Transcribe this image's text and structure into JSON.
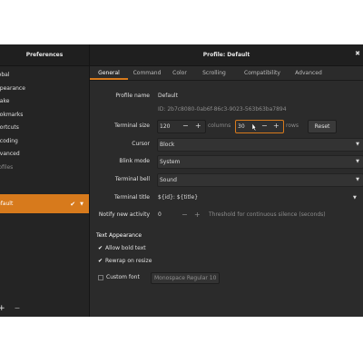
{
  "sidebar": {
    "title": "Preferences",
    "items": [
      {
        "label": "lobal"
      },
      {
        "label": "ppearance"
      },
      {
        "label": "uake"
      },
      {
        "label": "ookmarks"
      },
      {
        "label": "hortcuts"
      },
      {
        "label": "ncoding"
      },
      {
        "label": "dvanced"
      }
    ],
    "section_label": "rofiles",
    "profile": {
      "label": "efault"
    },
    "add_label": "+",
    "remove_label": "−"
  },
  "main": {
    "title": "Profile: Default",
    "tabs": [
      {
        "label": "General",
        "active": true
      },
      {
        "label": "Command"
      },
      {
        "label": "Color"
      },
      {
        "label": "Scrolling"
      },
      {
        "label": "Compatibility"
      },
      {
        "label": "Advanced"
      }
    ],
    "profile_name": {
      "label": "Profile name",
      "value": "Default"
    },
    "profile_id": "ID: 2b7c8080-0ab6f-86c3-9023-563b63ba7894",
    "terminal_size": {
      "label": "Terminal size",
      "columns_value": "120",
      "columns_label": "columns",
      "rows_value": "30",
      "rows_label": "rows",
      "reset_label": "Reset"
    },
    "cursor": {
      "label": "Cursor",
      "value": "Block"
    },
    "blink_mode": {
      "label": "Blink mode",
      "value": "System"
    },
    "terminal_bell": {
      "label": "Terminal bell",
      "value": "Sound"
    },
    "terminal_title": {
      "label": "Terminal title",
      "value": "${id}: ${title}"
    },
    "notify_activity": {
      "label": "Notify new activity",
      "value": "0",
      "hint": "Threshold for continuous silence (seconds)"
    },
    "text_appearance": {
      "title": "Text Appearance",
      "allow_bold": {
        "label": "Allow bold text",
        "checked": true
      },
      "rewrap": {
        "label": "Rewrap on resize",
        "checked": true
      },
      "custom_font": {
        "label": "Custom font",
        "checked": false
      },
      "font_button": "Monospace Regular  10"
    }
  },
  "colors": {
    "accent": "#d77a1c",
    "window_bg": "#2b2b2b",
    "sidebar_bg": "#242424"
  }
}
